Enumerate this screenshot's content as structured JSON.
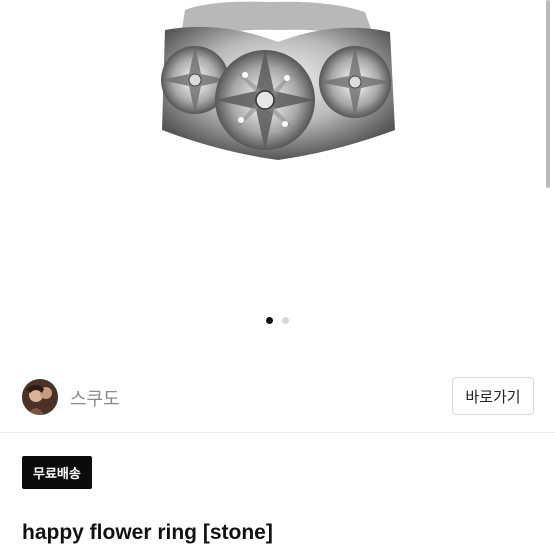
{
  "product": {
    "image_icon": "ring-photo",
    "carousel": {
      "total": 2,
      "active": 1
    }
  },
  "seller": {
    "name": "스쿠도",
    "avatar_icon": "avatar",
    "goto_label": "바로가기"
  },
  "badge": {
    "label": "무료배송"
  },
  "item": {
    "title": "happy flower ring [stone]"
  },
  "colors": {
    "badge_bg": "#0b0b0b",
    "dot_active": "#111111",
    "dot_inactive": "#d6d6d6",
    "seller_name": "#8a8a8a"
  }
}
